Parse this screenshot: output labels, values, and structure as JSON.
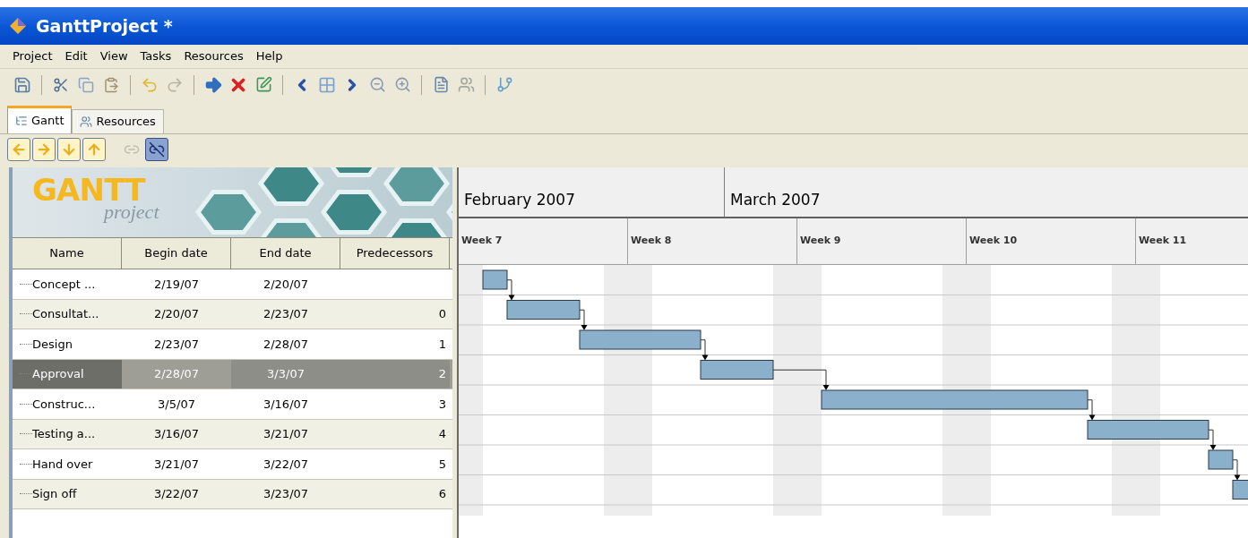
{
  "window": {
    "title": "GanttProject *"
  },
  "menu": [
    "Project",
    "Edit",
    "View",
    "Tasks",
    "Resources",
    "Help"
  ],
  "tabs": [
    {
      "label": "Gantt",
      "selected": true
    },
    {
      "label": "Resources",
      "selected": false
    }
  ],
  "logo": {
    "name": "GANTT",
    "subtitle": "project"
  },
  "table": {
    "columns": [
      "Name",
      "Begin date",
      "End date",
      "Predecessors"
    ],
    "rows": [
      {
        "name": "Concept ...",
        "begin": "2/19/07",
        "end": "2/20/07",
        "selected": false
      },
      {
        "name": "Consultat...",
        "begin": "2/20/07",
        "end": "2/23/07",
        "predecessors": "0",
        "selected": false
      },
      {
        "name": "Design",
        "begin": "2/23/07",
        "end": "2/28/07",
        "predecessors": "1",
        "selected": false
      },
      {
        "name": "Approval",
        "begin": "2/28/07",
        "end": "3/3/07",
        "predecessors": "2",
        "selected": true
      },
      {
        "name": "Construc...",
        "begin": "3/5/07",
        "end": "3/16/07",
        "predecessors": "3",
        "selected": false
      },
      {
        "name": "Testing a...",
        "begin": "3/16/07",
        "end": "3/21/07",
        "predecessors": "4",
        "selected": false
      },
      {
        "name": "Hand over",
        "begin": "3/21/07",
        "end": "3/22/07",
        "predecessors": "5",
        "selected": false
      },
      {
        "name": "Sign off",
        "begin": "3/22/07",
        "end": "3/23/07",
        "predecessors": "6",
        "selected": false
      }
    ]
  },
  "timeline": {
    "months": [
      "February 2007",
      "March 2007"
    ],
    "weeks": [
      "Week 7",
      "Week 8",
      "Week 9",
      "Week 10",
      "Week 11"
    ]
  }
}
